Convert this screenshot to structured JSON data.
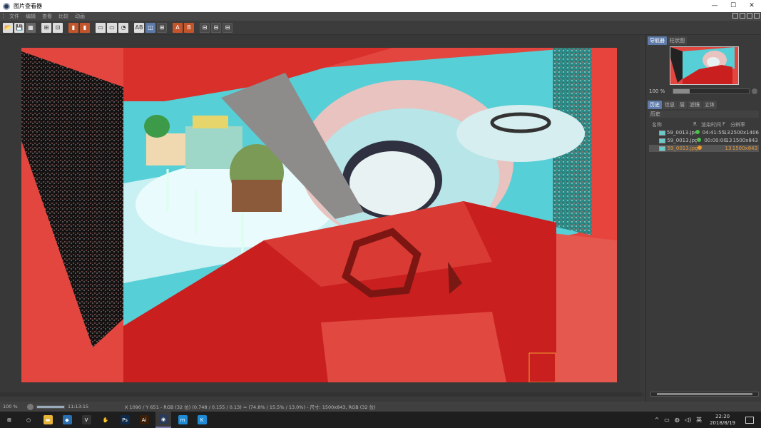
{
  "window": {
    "title": "图片查看器",
    "controls": {
      "minimize": "—",
      "maximize": "☐",
      "close": "✕"
    }
  },
  "menu": {
    "items": [
      "文件",
      "编辑",
      "查看",
      "比较",
      "动画"
    ]
  },
  "toolbar": {
    "buttons": [
      {
        "name": "open-file-button",
        "glyph": "📂",
        "style": "white"
      },
      {
        "name": "save-button",
        "glyph": "💾",
        "style": "white"
      },
      {
        "name": "render-button",
        "glyph": "▦",
        "style": "gray"
      },
      {
        "name": "region-button",
        "glyph": "⊞",
        "style": "white",
        "gap": true
      },
      {
        "name": "zoom-fit-button",
        "glyph": "⊡",
        "style": "white"
      },
      {
        "name": "layer-a-button",
        "glyph": "▮",
        "style": "orange",
        "gap": true
      },
      {
        "name": "layer-b-button",
        "glyph": "▮",
        "style": "orange"
      },
      {
        "name": "view-1-button",
        "glyph": "▭",
        "style": "white",
        "gap": true
      },
      {
        "name": "view-2-button",
        "glyph": "▭",
        "style": "white"
      },
      {
        "name": "view-3-button",
        "glyph": "◔",
        "style": "white"
      },
      {
        "name": "compare-ab-button",
        "glyph": "AB",
        "style": "white",
        "gap": true
      },
      {
        "name": "compare-split-button",
        "glyph": "◫",
        "style": "active"
      },
      {
        "name": "compare-grid-button",
        "glyph": "⊞",
        "style": "dark"
      },
      {
        "name": "channel-a-button",
        "glyph": "A",
        "style": "orange",
        "gap": true
      },
      {
        "name": "channel-b-button",
        "glyph": "B",
        "style": "orange"
      },
      {
        "name": "tile-1-button",
        "glyph": "⊟",
        "style": "dark",
        "gap": true
      },
      {
        "name": "tile-2-button",
        "glyph": "⊟",
        "style": "dark"
      },
      {
        "name": "tile-3-button",
        "glyph": "⊟",
        "style": "dark"
      }
    ]
  },
  "navigator": {
    "tabs": [
      "导航器",
      "柱状图"
    ],
    "active_tab": 0,
    "zoom_label": "100 %",
    "zoom_slider_fraction": 0.22
  },
  "history": {
    "tabs": [
      "历史",
      "信息",
      "层",
      "滤镜",
      "立体"
    ],
    "active_tab": 0,
    "header": "历史",
    "columns": {
      "name": "名称",
      "r": "R",
      "time": "渲染时间",
      "f": "F",
      "res": "分辨率"
    },
    "rows": [
      {
        "name": "59_0013.jpg",
        "time": "04:41:55",
        "f": "13",
        "res": "2500x1406",
        "dot": "#49c24a",
        "selected": false
      },
      {
        "name": "59_0013.jpg",
        "time": "00:00:00",
        "f": "13",
        "res": "1500x843",
        "dot": "#49c24a",
        "selected": false
      },
      {
        "name": "59_0013.jpg",
        "time": "",
        "f": "13",
        "res": "1500x843",
        "dot": "#e8962a",
        "selected": true
      }
    ]
  },
  "status": {
    "zoom": "100 %",
    "progress_fraction": 1.0,
    "elapsed": "11:13:15",
    "info": "X 1090 / Y 651 - RGB (32 位) (0.748 / 0.155 / 0.13) = (74.8% / 15.5% / 13.0%) - 尺寸: 1500x843, RGB (32 位)"
  },
  "taskbar": {
    "apps": [
      {
        "name": "start-icon",
        "glyph": "⊞",
        "color": "#1e1e1e"
      },
      {
        "name": "search-icon",
        "glyph": "○",
        "color": "#1e1e1e"
      },
      {
        "name": "file-explorer-icon",
        "glyph": "▬",
        "color": "#e8b53a"
      },
      {
        "name": "app-blue-icon",
        "glyph": "◆",
        "color": "#2a6fb0"
      },
      {
        "name": "app-v-icon",
        "glyph": "V",
        "color": "#333"
      },
      {
        "name": "app-hand-icon",
        "glyph": "✋",
        "color": "#1e1e1e"
      },
      {
        "name": "photoshop-icon",
        "glyph": "Ps",
        "color": "#0e2a4a"
      },
      {
        "name": "illustrator-icon",
        "glyph": "Ai",
        "color": "#3a1e08"
      },
      {
        "name": "cinema4d-icon",
        "glyph": "◉",
        "color": "#2a3a5a",
        "active": true
      },
      {
        "name": "app-m-icon",
        "glyph": "m",
        "color": "#1e8bd6"
      },
      {
        "name": "app-k-icon",
        "glyph": "K",
        "color": "#1e8bd6"
      }
    ],
    "tray": {
      "icons": [
        "^",
        "▭",
        "◍",
        "◁)",
        "英"
      ],
      "time": "22:20",
      "date": "2018/8/19"
    }
  }
}
